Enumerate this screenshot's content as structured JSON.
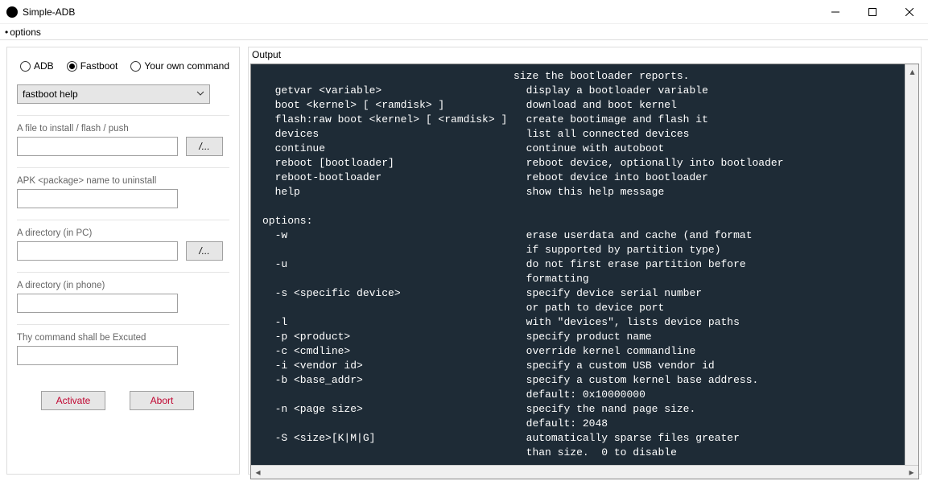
{
  "window": {
    "title": "Simple-ADB"
  },
  "menubar": {
    "options": "options"
  },
  "left": {
    "radios": {
      "adb": "ADB",
      "fastboot": "Fastboot",
      "owncmd": "Your own command",
      "selected": "fastboot"
    },
    "combo": {
      "value": "fastboot help"
    },
    "file": {
      "label": "A file to install / flash / push",
      "browse": "/..."
    },
    "apk": {
      "label": "APK <package> name to uninstall"
    },
    "dirpc": {
      "label": "A directory (in PC)",
      "browse": "/..."
    },
    "dirphone": {
      "label": "A directory (in phone)"
    },
    "cmd": {
      "label": "Thy command shall be Excuted"
    },
    "activate": "Activate",
    "abort": "Abort"
  },
  "output": {
    "label": "Output",
    "text": "                                        size the bootloader reports.\n  getvar <variable>                       display a bootloader variable\n  boot <kernel> [ <ramdisk> ]             download and boot kernel\n  flash:raw boot <kernel> [ <ramdisk> ]   create bootimage and flash it\n  devices                                 list all connected devices\n  continue                                continue with autoboot\n  reboot [bootloader]                     reboot device, optionally into bootloader\n  reboot-bootloader                       reboot device into bootloader\n  help                                    show this help message\n\noptions:\n  -w                                      erase userdata and cache (and format\n                                          if supported by partition type)\n  -u                                      do not first erase partition before\n                                          formatting\n  -s <specific device>                    specify device serial number\n                                          or path to device port\n  -l                                      with \"devices\", lists device paths\n  -p <product>                            specify product name\n  -c <cmdline>                            override kernel commandline\n  -i <vendor id>                          specify a custom USB vendor id\n  -b <base_addr>                          specify a custom kernel base address.\n                                          default: 0x10000000\n  -n <page size>                          specify the nand page size.\n                                          default: 2048\n  -S <size>[K|M|G]                        automatically sparse files greater\n                                          than size.  0 to disable"
  }
}
